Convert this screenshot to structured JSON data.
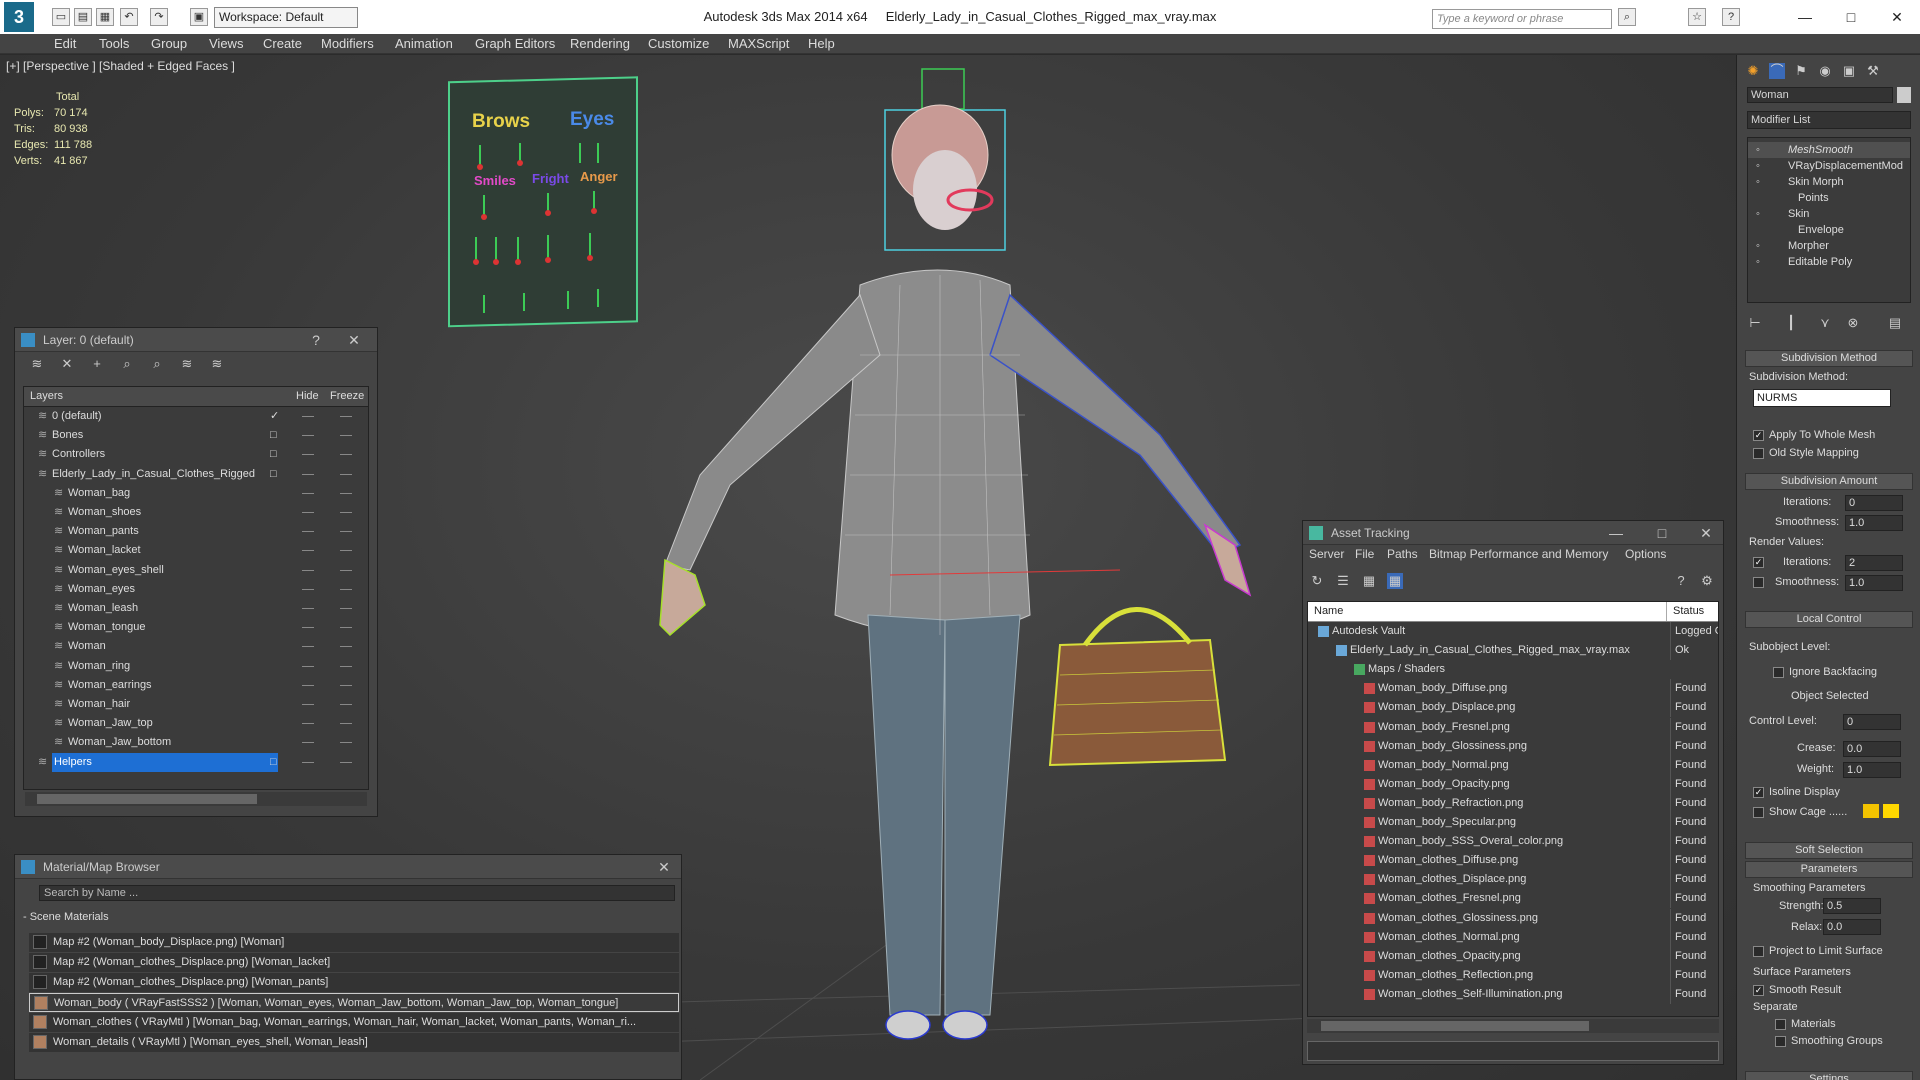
{
  "titlebar": {
    "app_title": "Autodesk 3ds Max  2014 x64",
    "file_name": "Elderly_Lady_in_Casual_Clothes_Rigged_max_vray.max",
    "workspace": "Workspace: Default",
    "search_placeholder": "Type a keyword or phrase"
  },
  "menu": [
    "Edit",
    "Tools",
    "Group",
    "Views",
    "Create",
    "Modifiers",
    "Animation",
    "Graph Editors",
    "Rendering",
    "Customize",
    "MAXScript",
    "Help"
  ],
  "viewport": {
    "label": "[+] [Perspective ] [Shaded + Edged Faces ]",
    "stats": {
      "header": "Total",
      "rows": [
        {
          "k": "Polys:",
          "v": "70 174"
        },
        {
          "k": "Tris:",
          "v": "80 938"
        },
        {
          "k": "Edges:",
          "v": "111 788"
        },
        {
          "k": "Verts:",
          "v": "41 867"
        }
      ]
    },
    "face_board": {
      "brows": "Brows",
      "eyes": "Eyes",
      "smiles": "Smiles",
      "fright": "Fright",
      "anger": "Anger"
    }
  },
  "layer_panel": {
    "title": "Layer: 0 (default)",
    "help": "?",
    "close": "✕",
    "columns": [
      "Layers",
      "Hide",
      "Freeze"
    ],
    "rows": [
      {
        "name": "0 (default)",
        "indent": 0,
        "check": "✓"
      },
      {
        "name": "Bones",
        "indent": 0,
        "check": "□"
      },
      {
        "name": "Controllers",
        "indent": 0,
        "check": "□"
      },
      {
        "name": "Elderly_Lady_in_Casual_Clothes_Rigged",
        "indent": 0,
        "check": "□"
      },
      {
        "name": "Woman_bag",
        "indent": 1,
        "check": ""
      },
      {
        "name": "Woman_shoes",
        "indent": 1,
        "check": ""
      },
      {
        "name": "Woman_pants",
        "indent": 1,
        "check": ""
      },
      {
        "name": "Woman_lacket",
        "indent": 1,
        "check": ""
      },
      {
        "name": "Woman_eyes_shell",
        "indent": 1,
        "check": ""
      },
      {
        "name": "Woman_eyes",
        "indent": 1,
        "check": ""
      },
      {
        "name": "Woman_leash",
        "indent": 1,
        "check": ""
      },
      {
        "name": "Woman_tongue",
        "indent": 1,
        "check": ""
      },
      {
        "name": "Woman",
        "indent": 1,
        "check": ""
      },
      {
        "name": "Woman_ring",
        "indent": 1,
        "check": ""
      },
      {
        "name": "Woman_earrings",
        "indent": 1,
        "check": ""
      },
      {
        "name": "Woman_hair",
        "indent": 1,
        "check": ""
      },
      {
        "name": "Woman_Jaw_top",
        "indent": 1,
        "check": ""
      },
      {
        "name": "Woman_Jaw_bottom",
        "indent": 1,
        "check": ""
      },
      {
        "name": "Helpers",
        "indent": 0,
        "check": "□",
        "selected": true
      }
    ]
  },
  "material_browser": {
    "title": "Material/Map Browser",
    "close": "✕",
    "search_placeholder": "Search by Name ...",
    "section": "- Scene Materials",
    "items": [
      "Map #2 (Woman_body_Displace.png) [Woman]",
      "Map #2 (Woman_clothes_Displace.png) [Woman_lacket]",
      "Map #2 (Woman_clothes_Displace.png) [Woman_pants]",
      "Woman_body  ( VRayFastSSS2 )  [Woman, Woman_eyes, Woman_Jaw_bottom, Woman_Jaw_top, Woman_tongue]",
      "Woman_clothes  ( VRayMtl )  [Woman_bag, Woman_earrings, Woman_hair, Woman_lacket, Woman_pants, Woman_ri...",
      "Woman_details  ( VRayMtl )  [Woman_eyes_shell, Woman_leash]"
    ]
  },
  "asset_tracking": {
    "title": "Asset Tracking",
    "menu": [
      "Server",
      "File",
      "Paths",
      "Bitmap Performance and Memory",
      "Options"
    ],
    "columns": [
      "Name",
      "Status"
    ],
    "rows": [
      {
        "name": "Autodesk Vault",
        "status": "Logged Ou",
        "indent": 0
      },
      {
        "name": "Elderly_Lady_in_Casual_Clothes_Rigged_max_vray.max",
        "status": "Ok",
        "indent": 1
      },
      {
        "name": "Maps / Shaders",
        "status": "",
        "indent": 2
      },
      {
        "name": "Woman_body_Diffuse.png",
        "status": "Found",
        "indent": 3
      },
      {
        "name": "Woman_body_Displace.png",
        "status": "Found",
        "indent": 3
      },
      {
        "name": "Woman_body_Fresnel.png",
        "status": "Found",
        "indent": 3
      },
      {
        "name": "Woman_body_Glossiness.png",
        "status": "Found",
        "indent": 3
      },
      {
        "name": "Woman_body_Normal.png",
        "status": "Found",
        "indent": 3
      },
      {
        "name": "Woman_body_Opacity.png",
        "status": "Found",
        "indent": 3
      },
      {
        "name": "Woman_body_Refraction.png",
        "status": "Found",
        "indent": 3
      },
      {
        "name": "Woman_body_Specular.png",
        "status": "Found",
        "indent": 3
      },
      {
        "name": "Woman_body_SSS_Overal_color.png",
        "status": "Found",
        "indent": 3
      },
      {
        "name": "Woman_clothes_Diffuse.png",
        "status": "Found",
        "indent": 3
      },
      {
        "name": "Woman_clothes_Displace.png",
        "status": "Found",
        "indent": 3
      },
      {
        "name": "Woman_clothes_Fresnel.png",
        "status": "Found",
        "indent": 3
      },
      {
        "name": "Woman_clothes_Glossiness.png",
        "status": "Found",
        "indent": 3
      },
      {
        "name": "Woman_clothes_Normal.png",
        "status": "Found",
        "indent": 3
      },
      {
        "name": "Woman_clothes_Opacity.png",
        "status": "Found",
        "indent": 3
      },
      {
        "name": "Woman_clothes_Reflection.png",
        "status": "Found",
        "indent": 3
      },
      {
        "name": "Woman_clothes_Self-Illumination.png",
        "status": "Found",
        "indent": 3
      }
    ]
  },
  "command_panel": {
    "object_name": "Woman",
    "modifier_list": "Modifier List",
    "stack": [
      {
        "name": "MeshSmooth",
        "italic": true
      },
      {
        "name": "VRayDisplacementMod"
      },
      {
        "name": "Skin Morph"
      },
      {
        "name": "Points",
        "sub": true
      },
      {
        "name": "Skin"
      },
      {
        "name": "Envelope",
        "sub": true
      },
      {
        "name": "Morpher"
      },
      {
        "name": "Editable Poly"
      }
    ],
    "subdivision_method_rollout": "Subdivision Method",
    "subdivision_method_label": "Subdivision Method:",
    "subdivision_method_value": "NURMS",
    "apply_whole_mesh": "Apply To Whole Mesh",
    "old_style": "Old Style Mapping",
    "subdivision_amount_rollout": "Subdivision Amount",
    "iterations_label": "Iterations:",
    "iterations_value": "0",
    "smoothness_label": "Smoothness:",
    "smoothness_value": "1.0",
    "render_values": "Render Values:",
    "render_iterations_value": "2",
    "render_smoothness_value": "1.0",
    "local_control_rollout": "Local Control",
    "subobject_level": "Subobject Level:",
    "ignore_backfacing": "Ignore Backfacing",
    "object_selected": "Object Selected",
    "control_level": "Control Level:",
    "control_level_value": "0",
    "crease": "Crease:",
    "crease_value": "0.0",
    "weight": "Weight:",
    "weight_value": "1.0",
    "isoline_display": "Isoline Display",
    "show_cage": "Show Cage ......",
    "soft_selection_rollout": "Soft Selection",
    "parameters_rollout": "Parameters",
    "smoothing_params": "Smoothing Parameters",
    "strength": "Strength:",
    "strength_value": "0.5",
    "relax": "Relax:",
    "relax_value": "0.0",
    "project_limit": "Project to Limit Surface",
    "surface_params": "Surface Parameters",
    "smooth_result": "Smooth Result",
    "separate": "Separate",
    "materials": "Materials",
    "smoothing_groups": "Smoothing Groups",
    "settings_rollout": "Settings"
  },
  "colors": {
    "accent": "#3a8ec4",
    "selection": "#1e6fd4",
    "cage1": "#f3c300",
    "cage2": "#ffd700"
  }
}
